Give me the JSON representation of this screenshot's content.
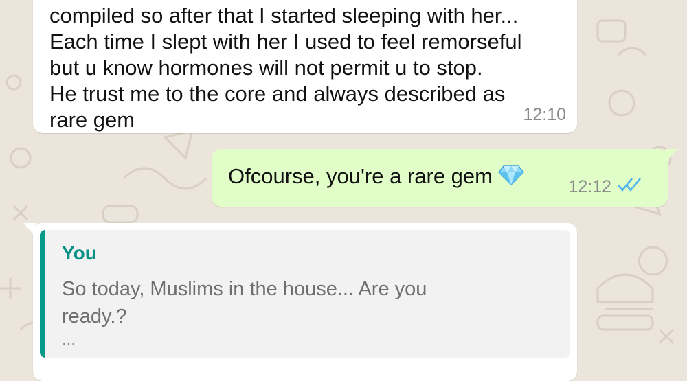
{
  "messages": [
    {
      "direction": "incoming",
      "lines": [
        "compiled so after that I started sleeping with her...",
        "Each time I slept with her I used to feel remorseful",
        "but u know hormones will not permit u to stop.",
        "He trust me to the core and always described as",
        "rare gem"
      ],
      "time": "12:10"
    },
    {
      "direction": "outgoing",
      "text": "Ofcourse, you're a rare gem",
      "emoji": "gem-stone-icon",
      "time": "12:12",
      "status": "read-double-check-icon"
    },
    {
      "direction": "incoming",
      "quote": {
        "author": "You",
        "lines": [
          "So today, Muslims in the house... Are you",
          "ready.?"
        ],
        "ellipsis": "..."
      }
    }
  ],
  "colors": {
    "background": "#ece5dc",
    "incoming_bubble": "#ffffff",
    "outgoing_bubble": "#e2fec8",
    "quote_accent": "#07998a",
    "read_ticks": "#4fb6ec"
  }
}
